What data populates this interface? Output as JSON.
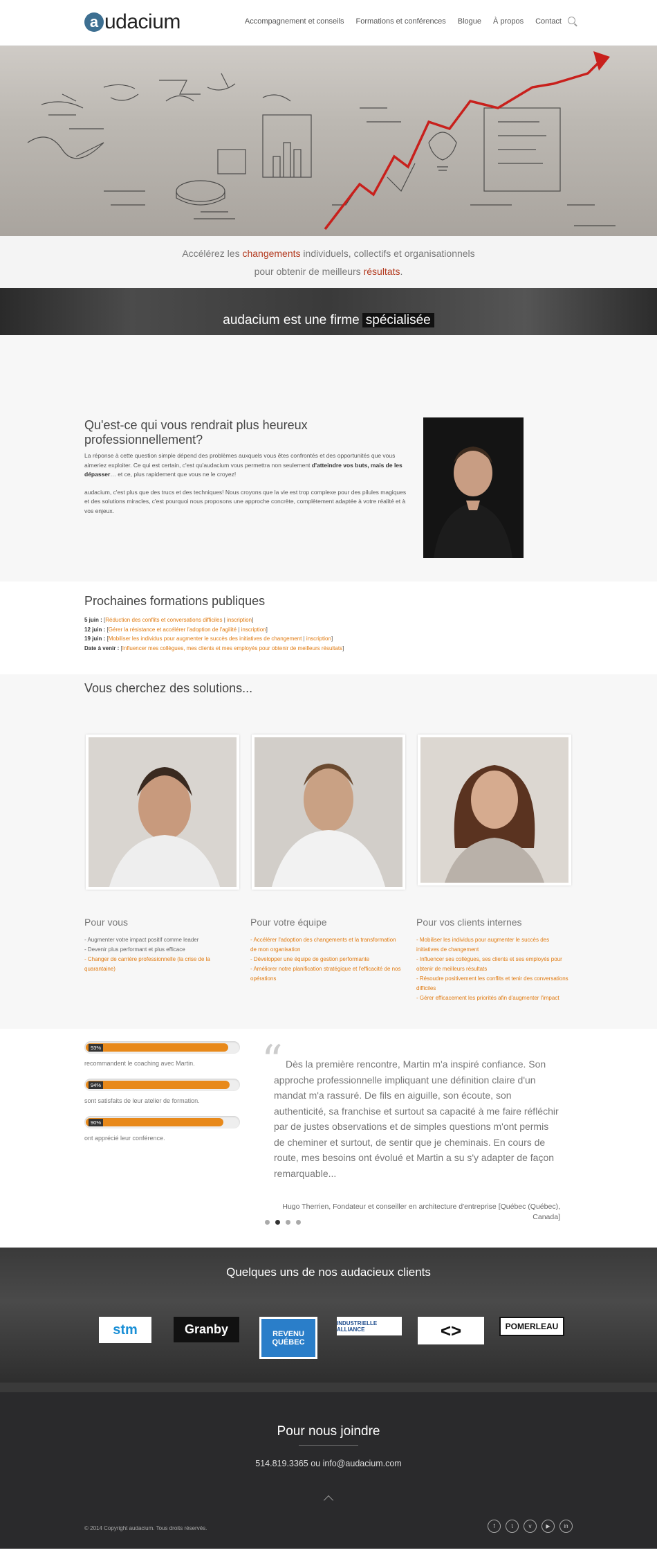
{
  "header": {
    "logo_mark": "a",
    "logo_text": "udacium",
    "nav": [
      "Accompagnement et conseils",
      "Formations et conférences",
      "Blogue",
      "À propos",
      "Contact"
    ]
  },
  "tagline": {
    "l1_a": "Accélérez les ",
    "l1_hl": "changements",
    "l1_b": " individuels, collectifs et organisationnels",
    "l2_a": "pour obtenir de meilleurs ",
    "l2_hl": "résultats",
    "l2_b": "."
  },
  "banner": {
    "text": "audacium est une firme",
    "highlight": "spécialisée"
  },
  "question": {
    "title": "Qu'est-ce qui vous rendrait plus heureux professionnellement?",
    "p1_a": "La réponse à cette question simple dépend des problèmes auxquels vous êtes confrontés et des opportunités que vous aimeriez exploiter. Ce qui est certain, c'est qu'audacium vous permettra non seulement ",
    "p1_b": "d'atteindre vos buts, mais de les dépasser",
    "p1_c": "… et ce, plus rapidement que vous ne le croyez!",
    "p2": "audacium, c'est plus que des trucs et des techniques! Nous croyons que la vie est trop complexe pour des pilules magiques et des solutions miracles, c'est pourquoi nous proposons une approche concrète, complètement adaptée à votre réalité et à vos enjeux."
  },
  "formations": {
    "title": "Prochaines formations publiques",
    "items": [
      {
        "date": "5 juin :",
        "title": "Réduction des conflits et conversations difficiles",
        "link": "inscription"
      },
      {
        "date": "12 juin :",
        "title": "Gérer la résistance et accélérer l'adoption de l'agilité",
        "link": "inscription"
      },
      {
        "date": "19 juin :",
        "title": "Mobiliser les individus pour augmenter le succès des initiatives de changement",
        "link": "inscription"
      },
      {
        "date": "Date à venir :",
        "title": "Influencer mes collègues, mes clients et mes employés pour obtenir de meilleurs résultats",
        "link": ""
      }
    ]
  },
  "solutions": {
    "title": "Vous cherchez des solutions...",
    "cols": [
      {
        "title": "Pour vous",
        "items": [
          [
            "Augmenter votre impact positif comme leader",
            false
          ],
          [
            "Devenir plus performant et plus efficace",
            false
          ],
          [
            "Changer de carrière professionnelle (la crise de la quarantaine)",
            true
          ]
        ]
      },
      {
        "title": "Pour votre équipe",
        "items": [
          [
            "Accélérer l'adoption des changements et la transformation de mon organisation",
            true
          ],
          [
            "Développer une équipe de gestion performante",
            true
          ],
          [
            "Améliorer notre planification stratégique et l'efficacité de nos opérations",
            true
          ]
        ]
      },
      {
        "title": "Pour vos clients internes",
        "items": [
          [
            "Mobiliser les individus pour augmenter le succès des initiatives de changement",
            true
          ],
          [
            "Influencer ses collègues, ses clients et ses employés pour obtenir de meilleurs résultats",
            true
          ],
          [
            "Résoudre positivement les conflits et tenir des conversations difficiles",
            true
          ],
          [
            "Gérer efficacement les priorités afin d'augmenter l'impact",
            true
          ]
        ]
      }
    ]
  },
  "stats": [
    {
      "pct": "93%",
      "value": 0.93,
      "label": "recommandent le coaching avec Martin."
    },
    {
      "pct": "94%",
      "value": 0.94,
      "label": "sont satisfaits de leur atelier de formation."
    },
    {
      "pct": "90%",
      "value": 0.9,
      "label": "ont apprécié leur conférence."
    }
  ],
  "testimonial": {
    "quote": "Dès la première rencontre, Martin m'a inspiré confiance. Son approche professionnelle impliquant une définition claire d'un mandat m'a rassuré. De fils en aiguille, son écoute, son authenticité, sa franchise et surtout sa capacité à me faire réfléchir par de justes observations et de simples questions m'ont permis de cheminer et surtout, de sentir que je cheminais. En cours de route, mes besoins ont évolué et Martin a su s'y adapter de façon remarquable...",
    "author": "Hugo Therrien, Fondateur et conseiller en architecture d'entreprise [Québec (Québec), Canada]"
  },
  "clients": {
    "title": "Quelques uns de nos audacieux clients",
    "logos": [
      "stm",
      "Granby",
      "REVENU QUÉBEC",
      "INDUSTRIELLE ALLIANCE",
      "<>",
      "POMERLEAU"
    ]
  },
  "footer": {
    "title": "Pour nous joindre",
    "contact": "514.819.3365 ou info@audacium.com",
    "copyright": "© 2014 Copyright audacium. Tous droits réservés.",
    "socials": [
      "f",
      "t",
      "v",
      "▶",
      "in"
    ]
  }
}
